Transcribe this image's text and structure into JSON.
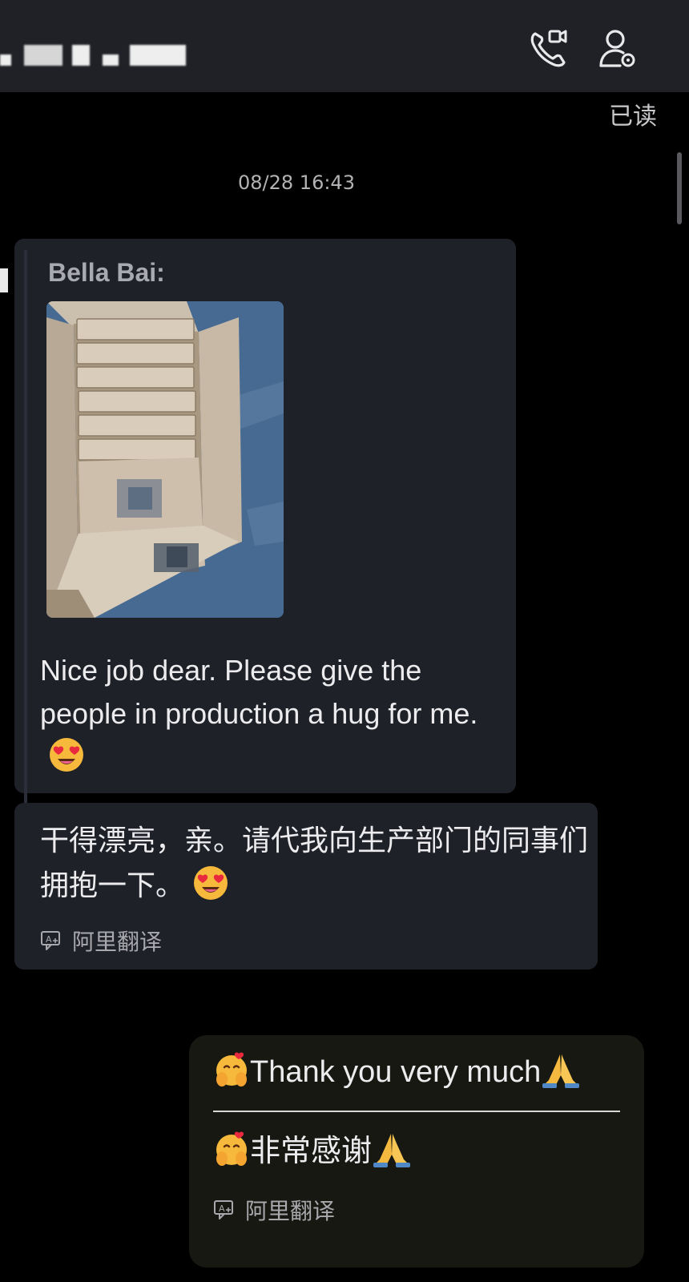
{
  "header": {
    "contact_name": "▇▇▇▇▇ (blurred)",
    "video_call_icon": "phone-video-icon",
    "profile_icon": "contact-settings-icon"
  },
  "read_status": "已读",
  "timestamp": "08/28 16:43",
  "incoming_message": {
    "sender": "Bella Bai:",
    "photo": "cardboard-box-of-packages",
    "text": "Nice job dear. Please give the people in production a hug for me.",
    "emoji": "heart-eyes-face"
  },
  "incoming_translation": {
    "text": "干得漂亮，亲。请代我向生产部门的同事们拥抱一下。",
    "emoji": "heart-eyes-face",
    "provider_label": "阿里翻译"
  },
  "outgoing_message": {
    "text": "Thank you very much",
    "leading_emoji": "hugging-face",
    "trailing_emoji": "folded-hands",
    "translation": "非常感谢",
    "provider_label": "阿里翻译"
  },
  "colors": {
    "background": "#000000",
    "header": "#1f2126",
    "incoming_bubble": "#1f2129",
    "outgoing_bubble": "#171811",
    "text": "#ececee",
    "muted": "#a8a8ad"
  }
}
